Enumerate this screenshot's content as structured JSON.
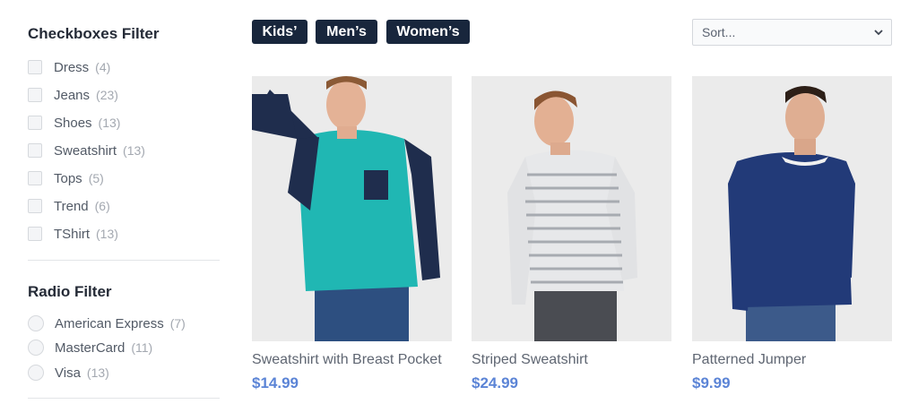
{
  "sidebar": {
    "checkbox_filter": {
      "title": "Checkboxes Filter",
      "items": [
        {
          "label": "Dress",
          "count": "(4)"
        },
        {
          "label": "Jeans",
          "count": "(23)"
        },
        {
          "label": "Shoes",
          "count": "(13)"
        },
        {
          "label": "Sweatshirt",
          "count": "(13)"
        },
        {
          "label": "Tops",
          "count": "(5)"
        },
        {
          "label": "Trend",
          "count": "(6)"
        },
        {
          "label": "TShirt",
          "count": "(13)"
        }
      ]
    },
    "radio_filter": {
      "title": "Radio Filter",
      "items": [
        {
          "label": "American Express",
          "count": "(7)"
        },
        {
          "label": "MasterCard",
          "count": "(11)"
        },
        {
          "label": "Visa",
          "count": "(13)"
        }
      ]
    }
  },
  "tags": [
    "Kids’",
    "Men’s",
    "Women’s"
  ],
  "sort": {
    "value": "Sort..."
  },
  "products": [
    {
      "name": "Sweatshirt with Breast Pocket",
      "price": "$14.99"
    },
    {
      "name": "Striped Sweatshirt",
      "price": "$24.99"
    },
    {
      "name": "Patterned Jumper",
      "price": "$9.99"
    }
  ],
  "colors": {
    "tag_bg": "#18263c",
    "price": "#5b84d6",
    "title": "#252b37"
  }
}
